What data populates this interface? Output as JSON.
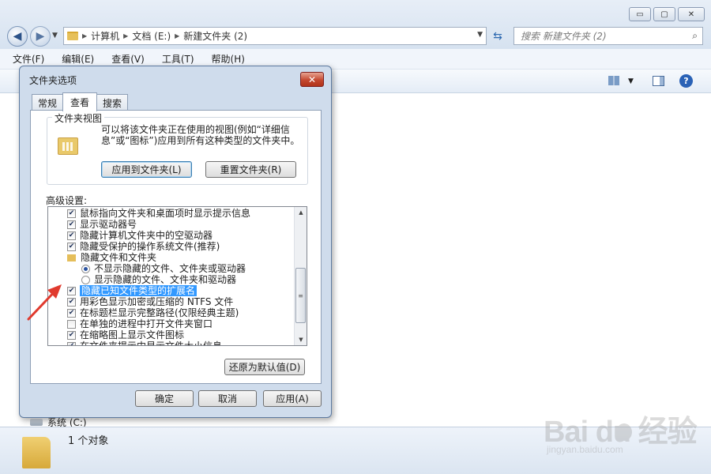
{
  "explorer": {
    "window_controls": {
      "minimize": "▭",
      "maximize": "▢",
      "close": "✕"
    },
    "breadcrumb": [
      "计算机",
      "文档 (E:)",
      "新建文件夹 (2)"
    ],
    "search_placeholder": "搜索 新建文件夹 (2)",
    "menu": [
      "文件(F)",
      "编辑(E)",
      "查看(V)",
      "工具(T)",
      "帮助(H)"
    ],
    "nav_drive": "系统 (C:)",
    "status_text": "1 个对象"
  },
  "dialog": {
    "title": "文件夹选项",
    "close_label": "✕",
    "tabs": [
      "常规",
      "查看",
      "搜索"
    ],
    "active_tab": "查看",
    "folder_view": {
      "title": "文件夹视图",
      "description": "可以将该文件夹正在使用的视图(例如“详细信息”或“图标”)应用到所有这种类型的文件夹中。",
      "apply_button": "应用到文件夹(L)",
      "reset_button": "重置文件夹(R)"
    },
    "advanced_label": "高级设置:",
    "advanced_items": [
      {
        "type": "checkbox",
        "checked": true,
        "label": "鼠标指向文件夹和桌面项时显示提示信息"
      },
      {
        "type": "checkbox",
        "checked": true,
        "label": "显示驱动器号"
      },
      {
        "type": "checkbox",
        "checked": true,
        "label": "隐藏计算机文件夹中的空驱动器"
      },
      {
        "type": "checkbox",
        "checked": true,
        "label": "隐藏受保护的操作系统文件(推荐)"
      },
      {
        "type": "folder",
        "label": "隐藏文件和文件夹"
      },
      {
        "type": "radio",
        "checked": true,
        "label": "不显示隐藏的文件、文件夹或驱动器"
      },
      {
        "type": "radio",
        "checked": false,
        "label": "显示隐藏的文件、文件夹和驱动器"
      },
      {
        "type": "checkbox",
        "checked": true,
        "label": "隐藏已知文件类型的扩展名",
        "highlighted": true
      },
      {
        "type": "checkbox",
        "checked": true,
        "label": "用彩色显示加密或压缩的 NTFS 文件"
      },
      {
        "type": "checkbox",
        "checked": true,
        "label": "在标题栏显示完整路径(仅限经典主题)"
      },
      {
        "type": "checkbox",
        "checked": false,
        "label": "在单独的进程中打开文件夹窗口"
      },
      {
        "type": "checkbox",
        "checked": true,
        "label": "在缩略图上显示文件图标"
      },
      {
        "type": "checkbox",
        "checked": true,
        "label": "在文件夹提示中显示文件大小信息"
      }
    ],
    "restore_button": "还原为默认值(D)",
    "ok_button": "确定",
    "cancel_button": "取消",
    "apply_button": "应用(A)"
  },
  "watermark": {
    "brand": "Bai du 经验",
    "url": "jingyan.baidu.com"
  }
}
